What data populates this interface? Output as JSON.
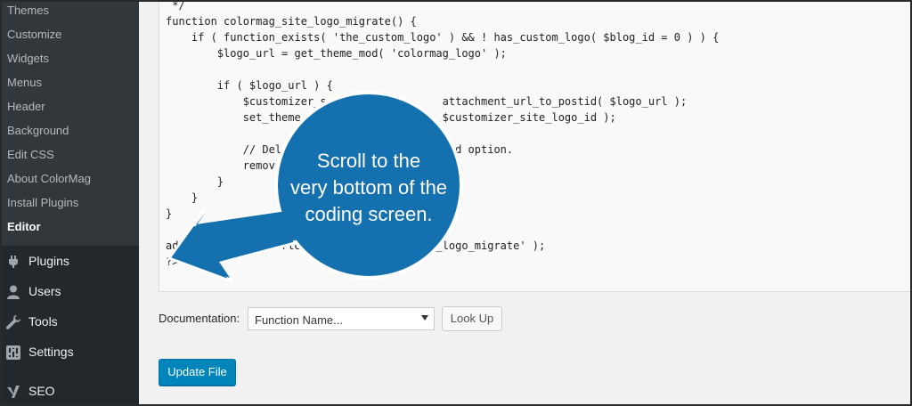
{
  "sidebar": {
    "submenu": [
      "Themes",
      "Customize",
      "Widgets",
      "Menus",
      "Header",
      "Background",
      "Edit CSS",
      "About ColorMag",
      "Install Plugins",
      "Editor"
    ],
    "current": "Editor",
    "menu": [
      {
        "label": "Plugins",
        "icon": "plug-icon"
      },
      {
        "label": "Users",
        "icon": "user-icon"
      },
      {
        "label": "Tools",
        "icon": "wrench-icon"
      },
      {
        "label": "Settings",
        "icon": "settings-icon"
      },
      {
        "label": "SEO",
        "icon": "yoast-icon"
      }
    ]
  },
  "editor": {
    "code_lines": [
      " */",
      "function colormag_site_logo_migrate() {",
      "    if ( function_exists( 'the_custom_logo' ) && ! has_custom_logo( $blog_id = 0 ) ) {",
      "        $logo_url = get_theme_mod( 'colormag_logo' );",
      "",
      "        if ( $logo_url ) {",
      "            $customizer_s                  attachment_url_to_postid( $logo_url );",
      "            set_theme_                     $customizer_site_logo_id );",
      "",
      "            // Del                         mod option.",
      "            remov                         );",
      "        }",
      "    }",
      "}",
      "",
      "add_              rter_s              site_logo_migrate' );",
      "?>"
    ]
  },
  "documentation": {
    "label": "Documentation:",
    "selected": "Function Name...",
    "lookup_label": "Look Up"
  },
  "update_label": "Update File",
  "callout": {
    "lines": [
      "Scroll to the",
      "very bottom of the",
      "coding screen."
    ],
    "color": "#1570b0"
  }
}
